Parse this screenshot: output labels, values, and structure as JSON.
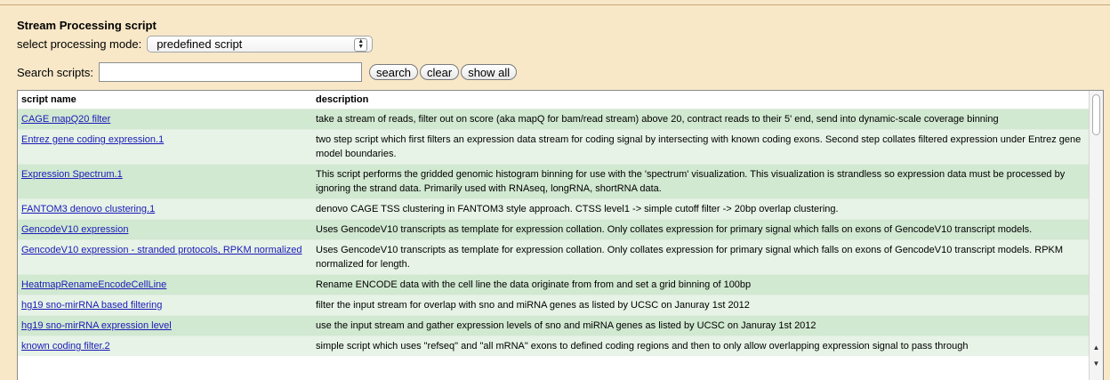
{
  "header": {
    "title": "Stream Processing script"
  },
  "mode": {
    "label": "select processing mode:",
    "selected": "predefined script"
  },
  "search": {
    "label": "Search scripts:",
    "value": "",
    "placeholder": ""
  },
  "buttons": {
    "search": "search",
    "clear": "clear",
    "show_all": "show all"
  },
  "table": {
    "columns": [
      "script name",
      "description"
    ],
    "rows": [
      {
        "name": "CAGE mapQ20 filter",
        "description": "take a stream of reads, filter out on score (aka mapQ for bam/read stream) above 20, contract reads to their 5' end, send into dynamic-scale coverage binning"
      },
      {
        "name": "Entrez gene coding expression.1",
        "description": "two step script which first filters an expression data stream for coding signal by intersecting with known coding exons. Second step collates filtered expression under Entrez gene model boundaries."
      },
      {
        "name": "Expression Spectrum.1",
        "description": "This script performs the gridded genomic histogram binning for use with the 'spectrum' visualization. This visualization is strandless so expression data must be processed by ignoring the strand data. Primarily used with RNAseq, longRNA, shortRNA data."
      },
      {
        "name": "FANTOM3 denovo clustering.1",
        "description": "denovo CAGE TSS clustering in FANTOM3 style approach. CTSS level1 -> simple cutoff filter -> 20bp overlap clustering."
      },
      {
        "name": "GencodeV10 expression",
        "description": "Uses GencodeV10 transcripts as template for expression collation. Only collates expression for primary signal which falls on exons of GencodeV10 transcript models."
      },
      {
        "name": "GencodeV10 expression - stranded protocols, RPKM normalized",
        "description": "Uses GencodeV10 transcripts as template for expression collation. Only collates expression for primary signal which falls on exons of GencodeV10 transcript models. RPKM normalized for length."
      },
      {
        "name": "HeatmapRenameEncodeCellLine",
        "description": "Rename ENCODE data with the cell line the data originate from from and set a grid binning of 100bp"
      },
      {
        "name": "hg19 sno-mirRNA based filtering",
        "description": "filter the input stream for overlap with sno and miRNA genes as listed by UCSC on Januray 1st 2012"
      },
      {
        "name": "hg19 sno-mirRNA expression level",
        "description": "use the input stream and gather expression levels of sno and miRNA genes as listed by UCSC on Januray 1st 2012"
      },
      {
        "name": "known coding filter.2",
        "description": "simple script which uses \"refseq\" and \"all mRNA\" exons to defined coding regions and then to only allow overlapping expression signal to pass through"
      }
    ]
  },
  "scrollbar": {
    "up_icon": "triangle-up",
    "down_icon": "triangle-down"
  }
}
